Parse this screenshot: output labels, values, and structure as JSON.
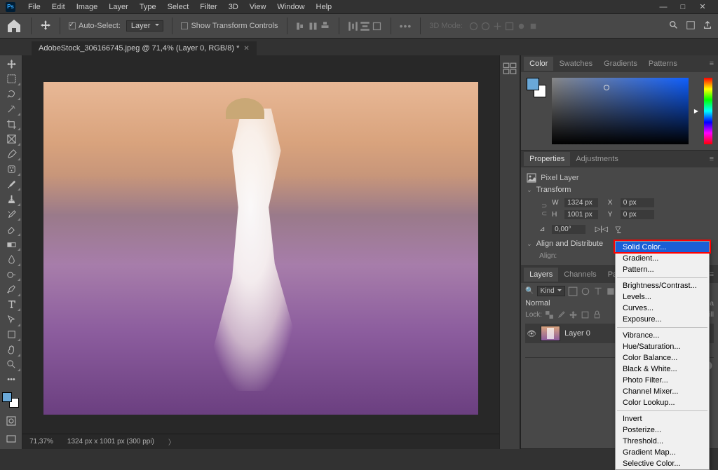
{
  "menu": {
    "items": [
      "File",
      "Edit",
      "Image",
      "Layer",
      "Type",
      "Select",
      "Filter",
      "3D",
      "View",
      "Window",
      "Help"
    ]
  },
  "options": {
    "auto_select_label": "Auto-Select:",
    "target": "Layer",
    "show_transform_label": "Show Transform Controls",
    "mode3d": "3D Mode:"
  },
  "tab": {
    "title": "AdobeStock_306166745.jpeg @ 71,4% (Layer 0, RGB/8) *"
  },
  "status": {
    "zoom": "71,37%",
    "dims": "1324 px x 1001 px (300 ppi)"
  },
  "color_panel": {
    "tabs": [
      "Color",
      "Swatches",
      "Gradients",
      "Patterns"
    ]
  },
  "properties_panel": {
    "tabs": [
      "Properties",
      "Adjustments"
    ],
    "pixel_layer_label": "Pixel Layer",
    "transform_label": "Transform",
    "w_label": "W",
    "w_val": "1324 px",
    "h_label": "H",
    "h_val": "1001 px",
    "x_label": "X",
    "x_val": "0 px",
    "y_label": "Y",
    "y_val": "0 px",
    "angle_label": "⊿",
    "angle_val": "0,00°",
    "align_label": "Align and Distribute",
    "align_sub": "Align:"
  },
  "layers_panel": {
    "tabs": [
      "Layers",
      "Channels",
      "Paths"
    ],
    "kind_label": "Kind",
    "blend_mode": "Normal",
    "opacity_label": "Opa",
    "lock_label": "Lock:",
    "fill_label": "Fill",
    "layer_name": "Layer 0"
  },
  "context_menu": {
    "items_group1": [
      "Solid Color...",
      "Gradient...",
      "Pattern..."
    ],
    "items_group2": [
      "Brightness/Contrast...",
      "Levels...",
      "Curves...",
      "Exposure..."
    ],
    "items_group3": [
      "Vibrance...",
      "Hue/Saturation...",
      "Color Balance...",
      "Black & White...",
      "Photo Filter...",
      "Channel Mixer...",
      "Color Lookup..."
    ],
    "items_group4": [
      "Invert",
      "Posterize...",
      "Threshold...",
      "Gradient Map...",
      "Selective Color..."
    ]
  }
}
